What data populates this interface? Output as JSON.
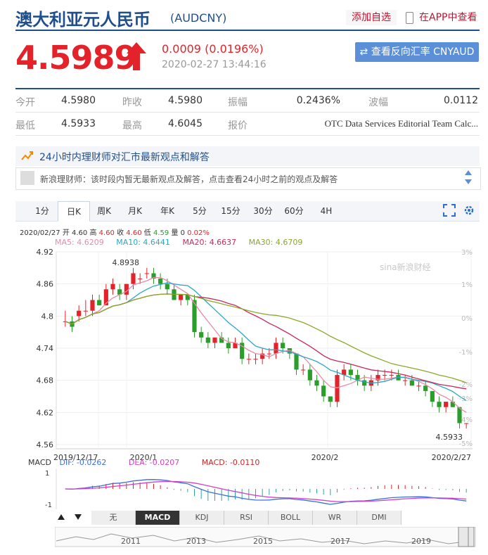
{
  "header": {
    "name": "澳大利亚元人民币",
    "code": "(AUDCNY)",
    "add_fav": "添加自选",
    "app_view": "在APP中查看"
  },
  "quote": {
    "price": "4.5989",
    "change": "0.0009 (0.0196%)",
    "time": "2020-02-27 13:44:16",
    "reverse_btn": "⇄ 查看反向汇率 CNYAUD",
    "rows": [
      [
        {
          "l": "今开",
          "v": "4.5980"
        },
        {
          "l": "昨收",
          "v": "4.5980"
        },
        {
          "l": "振幅",
          "v": "0.2436%"
        },
        {
          "l": "波幅",
          "v": "0.0112"
        }
      ],
      [
        {
          "l": "最低",
          "v": "4.5933"
        },
        {
          "l": "最高",
          "v": "4.6045"
        },
        {
          "l": "报价",
          "v": "OTC Data Services Editorial Team Calc..."
        }
      ]
    ]
  },
  "advisor": {
    "title": "24小时内理财师对汇市最新观点和解答",
    "message": "新浪理财师：该时段内暂无最新观点及解答，点击查看24小时之前的观点及解答"
  },
  "tabs": [
    "1分",
    "日K",
    "周K",
    "月K",
    "年K",
    "5分",
    "15分",
    "30分",
    "60分",
    "4H"
  ],
  "active_tab": "日K",
  "ohlc": {
    "date": "2020/02/27",
    "open_l": "开",
    "open": "4.60",
    "high_l": "高",
    "high": "4.60",
    "close_l": "收",
    "close": "4.60",
    "low_l": "低",
    "low": "4.59",
    "vol_l": "量",
    "vol": "0",
    "pct": "0.02%"
  },
  "ma": [
    {
      "label": "MA5: 4.6209",
      "color": "#e88aa8"
    },
    {
      "label": "MA10: 4.6441",
      "color": "#2aa7c7"
    },
    {
      "label": "MA20: 4.6637",
      "color": "#c8285a"
    },
    {
      "label": "MA30: 4.6709",
      "color": "#8aa82a"
    }
  ],
  "macd": {
    "name": "MACD",
    "dif": "DIF: -0.0262",
    "dea": "DEA: -0.0207",
    "macd": "MACD: -0.0110"
  },
  "indicators": [
    "无",
    "MACD",
    "KDJ",
    "RSI",
    "BOLL",
    "WR",
    "DMI"
  ],
  "active_indicator": "MACD",
  "watermark": "sina新浪财经",
  "colors": {
    "up": "#e4222a",
    "down": "#2a9d2a",
    "accent": "#1f4e8c"
  },
  "chart_data": {
    "type": "candlestick",
    "y_ticks": [
      "4.92",
      "4.86",
      "4.8",
      "4.74",
      "4.68",
      "4.62",
      "4.56"
    ],
    "ylim": [
      4.56,
      4.92
    ],
    "pct_ticks": [
      "3%",
      "1%",
      "0%",
      "-1%",
      "-2%",
      "-3%",
      "-4%",
      "-5%"
    ],
    "x_labels": [
      "2019/12/17",
      "2020/1",
      "2020/2",
      "2020/2/27"
    ],
    "max_label": "4.8938",
    "min_label": "4.5933",
    "candles": [
      [
        4.79,
        4.81,
        4.78,
        4.79
      ],
      [
        4.79,
        4.8,
        4.77,
        4.78
      ],
      [
        4.8,
        4.82,
        4.79,
        4.81
      ],
      [
        4.81,
        4.83,
        4.8,
        4.81
      ],
      [
        4.81,
        4.84,
        4.8,
        4.83
      ],
      [
        4.83,
        4.84,
        4.82,
        4.82
      ],
      [
        4.82,
        4.86,
        4.82,
        4.85
      ],
      [
        4.85,
        4.87,
        4.84,
        4.86
      ],
      [
        4.85,
        4.86,
        4.83,
        4.84
      ],
      [
        4.84,
        4.86,
        4.83,
        4.86
      ],
      [
        4.86,
        4.89,
        4.85,
        4.88
      ],
      [
        4.87,
        4.88,
        4.86,
        4.87
      ],
      [
        4.88,
        4.89,
        4.87,
        4.88
      ],
      [
        4.88,
        4.89,
        4.86,
        4.87
      ],
      [
        4.87,
        4.88,
        4.85,
        4.86
      ],
      [
        4.86,
        4.87,
        4.84,
        4.85
      ],
      [
        4.85,
        4.86,
        4.83,
        4.83
      ],
      [
        4.83,
        4.84,
        4.82,
        4.84
      ],
      [
        4.84,
        4.84,
        4.82,
        4.83
      ],
      [
        4.83,
        4.84,
        4.76,
        4.77
      ],
      [
        4.77,
        4.78,
        4.75,
        4.76
      ],
      [
        4.76,
        4.77,
        4.74,
        4.75
      ],
      [
        4.75,
        4.76,
        4.74,
        4.76
      ],
      [
        4.76,
        4.77,
        4.75,
        4.75
      ],
      [
        4.75,
        4.76,
        4.73,
        4.74
      ],
      [
        4.74,
        4.76,
        4.74,
        4.75
      ],
      [
        4.75,
        4.76,
        4.71,
        4.72
      ],
      [
        4.72,
        4.73,
        4.71,
        4.72
      ],
      [
        4.72,
        4.73,
        4.71,
        4.72
      ],
      [
        4.72,
        4.74,
        4.71,
        4.73
      ],
      [
        4.73,
        4.74,
        4.72,
        4.73
      ],
      [
        4.73,
        4.76,
        4.72,
        4.75
      ],
      [
        4.75,
        4.76,
        4.73,
        4.74
      ],
      [
        4.74,
        4.74,
        4.72,
        4.73
      ],
      [
        4.73,
        4.73,
        4.69,
        4.7
      ],
      [
        4.7,
        4.71,
        4.69,
        4.7
      ],
      [
        4.7,
        4.71,
        4.67,
        4.68
      ],
      [
        4.68,
        4.69,
        4.66,
        4.67
      ],
      [
        4.67,
        4.68,
        4.64,
        4.65
      ],
      [
        4.65,
        4.65,
        4.63,
        4.64
      ],
      [
        4.64,
        4.7,
        4.63,
        4.69
      ],
      [
        4.69,
        4.71,
        4.68,
        4.7
      ],
      [
        4.7,
        4.71,
        4.68,
        4.69
      ],
      [
        4.69,
        4.7,
        4.67,
        4.68
      ],
      [
        4.68,
        4.69,
        4.66,
        4.67
      ],
      [
        4.67,
        4.69,
        4.66,
        4.68
      ],
      [
        4.68,
        4.7,
        4.67,
        4.69
      ],
      [
        4.69,
        4.7,
        4.68,
        4.69
      ],
      [
        4.69,
        4.7,
        4.68,
        4.69
      ],
      [
        4.69,
        4.7,
        4.68,
        4.68
      ],
      [
        4.68,
        4.69,
        4.67,
        4.68
      ],
      [
        4.68,
        4.69,
        4.67,
        4.67
      ],
      [
        4.67,
        4.68,
        4.66,
        4.67
      ],
      [
        4.67,
        4.68,
        4.65,
        4.66
      ],
      [
        4.66,
        4.66,
        4.63,
        4.64
      ],
      [
        4.64,
        4.65,
        4.62,
        4.63
      ],
      [
        4.63,
        4.64,
        4.62,
        4.64
      ],
      [
        4.64,
        4.65,
        4.63,
        4.63
      ],
      [
        4.63,
        4.63,
        4.59,
        4.6
      ],
      [
        4.6,
        4.6,
        4.59,
        4.6
      ]
    ]
  }
}
